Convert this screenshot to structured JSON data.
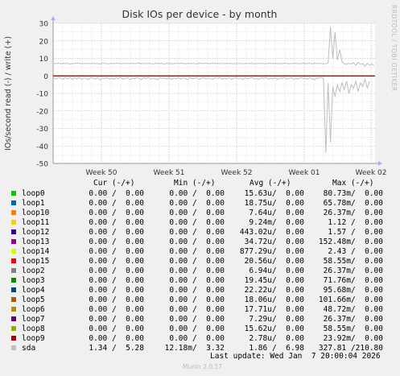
{
  "chart_data": {
    "type": "line",
    "title": "Disk IOs per device - by month",
    "ylabel": "IOs/second read (-) / write (+)",
    "ylim": [
      -50,
      30
    ],
    "yticks": [
      "30",
      "20",
      "10",
      "0",
      "-10",
      "-20",
      "-30",
      "-40",
      "-50"
    ],
    "xticks": [
      "Week 50",
      "Week 51",
      "Week 52",
      "Week 01",
      "Week 02"
    ],
    "grid": true,
    "sda_write": [
      7.2,
      7.0,
      7.3,
      6.9,
      7.1,
      7.0,
      7.2,
      6.8,
      7.1,
      7.0,
      7.3,
      7.1,
      6.9,
      7.2,
      7.0,
      7.1,
      6.9,
      7.2,
      7.0,
      7.1,
      6.8,
      7.2,
      7.1,
      7.0,
      6.9,
      7.2,
      7.0,
      7.1,
      7.3,
      6.9,
      7.0,
      7.2,
      7.1,
      6.9,
      7.2,
      7.0,
      7.1,
      7.3,
      6.9,
      7.1,
      7.0,
      7.2,
      7.0,
      6.9,
      7.1,
      7.2,
      7.0,
      7.1,
      6.8,
      7.2,
      7.0,
      7.1,
      6.9,
      7.3,
      7.0,
      7.1,
      7.2,
      6.9,
      7.0,
      7.2,
      7.1,
      7.0,
      6.9,
      7.2,
      7.1,
      7.0,
      7.3,
      6.9,
      7.1,
      7.2,
      7.0,
      7.1,
      6.9,
      7.2,
      7.0,
      7.1,
      7.0,
      7.2,
      6.9,
      7.1,
      7.0,
      7.2,
      6.9,
      7.1,
      7.0,
      7.2,
      7.1,
      6.9,
      7.0,
      7.2,
      7.1,
      7.0,
      6.9,
      7.2,
      7.1,
      7.0,
      7.2,
      6.9,
      7.1,
      7.0,
      7.2,
      7.1,
      6.9,
      7.0,
      7.2,
      7.1,
      7.0,
      6.9,
      7.3,
      7.0,
      7.1,
      7.2,
      6.9,
      7.1,
      7.0,
      7.2,
      7.1,
      6.9,
      7.0,
      7.2,
      28,
      10,
      25,
      9,
      15,
      8,
      7,
      6.5,
      7.2,
      6.8,
      7.5,
      6.0,
      7.8,
      6.5,
      7.0,
      5.5,
      7.2,
      6.0,
      6.8,
      5.8
    ],
    "sda_read": [
      -1.0,
      -1.8,
      -0.8,
      -1.5,
      -2.0,
      -1.0,
      -1.6,
      -0.9,
      -2.2,
      -1.1,
      -1.7,
      -0.8,
      -1.9,
      -1.2,
      -1.5,
      -2.1,
      -0.9,
      -1.4,
      -1.8,
      -1.0,
      -2.3,
      -1.2,
      -1.6,
      -0.9,
      -1.8,
      -1.3,
      -2.0,
      -1.1,
      -1.5,
      -0.8,
      -1.9,
      -1.4,
      -1.0,
      -2.2,
      -1.2,
      -1.7,
      -0.9,
      -1.6,
      -2.0,
      -1.1,
      -1.4,
      -0.8,
      -1.9,
      -1.3,
      -1.7,
      -2.1,
      -1.0,
      -1.5,
      -1.2,
      -1.8,
      -0.9,
      -2.0,
      -1.3,
      -1.6,
      -1.0,
      -1.9,
      -1.2,
      -1.5,
      -2.2,
      -0.9,
      -1.7,
      -1.3,
      -1.1,
      -2.0,
      -1.4,
      -0.8,
      -1.8,
      -1.2,
      -1.6,
      -2.1,
      -1.0,
      -1.5,
      -0.9,
      -1.9,
      -1.3,
      -1.7,
      -1.1,
      -2.0,
      -1.4,
      -0.8,
      -1.6,
      -1.2,
      -2.2,
      -1.0,
      -1.7,
      -1.3,
      -0.9,
      -1.8,
      -1.5,
      -2.0,
      -1.1,
      -1.4,
      -0.9,
      -1.9,
      -1.3,
      -1.6,
      -1.0,
      -2.1,
      -1.2,
      -1.5,
      -0.8,
      -1.8,
      -1.4,
      -1.1,
      -2.0,
      -1.3,
      -1.7,
      -0.9,
      -1.5,
      -1.2,
      -1.9,
      -1.0,
      -1.6,
      -2.2,
      -1.1,
      -1.4,
      -0.8,
      -1.7,
      -44,
      -4,
      -38,
      -6,
      -12,
      -5,
      -9,
      -4,
      -8,
      -3,
      -10,
      -5,
      -7,
      -3,
      -9,
      -4,
      -6,
      -2,
      -7,
      -3
    ],
    "threshold_line": 0
  },
  "legend": {
    "headers": [
      "Cur (-/+)",
      "Min (-/+)",
      "Avg (-/+)",
      "Max (-/+)"
    ],
    "rows": [
      {
        "name": "loop0",
        "color": "#00cc00",
        "cur": "0.00 /  0.00",
        "min": "0.00 /  0.00",
        "avg": "15.63u/  0.00",
        "max": "80.73m/  0.00"
      },
      {
        "name": "loop1",
        "color": "#0066b3",
        "cur": "0.00 /  0.00",
        "min": "0.00 /  0.00",
        "avg": "18.75u/  0.00",
        "max": "65.78m/  0.00"
      },
      {
        "name": "loop10",
        "color": "#ff8000",
        "cur": "0.00 /  0.00",
        "min": "0.00 /  0.00",
        "avg": "7.64u/  0.00",
        "max": "26.37m/  0.00"
      },
      {
        "name": "loop11",
        "color": "#ffcc00",
        "cur": "0.00 /  0.00",
        "min": "0.00 /  0.00",
        "avg": "9.24m/  0.00",
        "max": "1.12 /  0.00"
      },
      {
        "name": "loop12",
        "color": "#330099",
        "cur": "0.00 /  0.00",
        "min": "0.00 /  0.00",
        "avg": "443.02u/  0.00",
        "max": "1.57 /  0.00"
      },
      {
        "name": "loop13",
        "color": "#990099",
        "cur": "0.00 /  0.00",
        "min": "0.00 /  0.00",
        "avg": "34.72u/  0.00",
        "max": "152.48m/  0.00"
      },
      {
        "name": "loop14",
        "color": "#ccff00",
        "cur": "0.00 /  0.00",
        "min": "0.00 /  0.00",
        "avg": "877.29u/  0.00",
        "max": "2.43 /  0.00"
      },
      {
        "name": "loop15",
        "color": "#ff0000",
        "cur": "0.00 /  0.00",
        "min": "0.00 /  0.00",
        "avg": "20.56u/  0.00",
        "max": "58.55m/  0.00"
      },
      {
        "name": "loop2",
        "color": "#808080",
        "cur": "0.00 /  0.00",
        "min": "0.00 /  0.00",
        "avg": "6.94u/  0.00",
        "max": "26.37m/  0.00"
      },
      {
        "name": "loop3",
        "color": "#008f00",
        "cur": "0.00 /  0.00",
        "min": "0.00 /  0.00",
        "avg": "19.45u/  0.00",
        "max": "71.76m/  0.00"
      },
      {
        "name": "loop4",
        "color": "#00487d",
        "cur": "0.00 /  0.00",
        "min": "0.00 /  0.00",
        "avg": "22.22u/  0.00",
        "max": "95.68m/  0.00"
      },
      {
        "name": "loop5",
        "color": "#b35a00",
        "cur": "0.00 /  0.00",
        "min": "0.00 /  0.00",
        "avg": "18.06u/  0.00",
        "max": "101.66m/  0.00"
      },
      {
        "name": "loop6",
        "color": "#b38f00",
        "cur": "0.00 /  0.00",
        "min": "0.00 /  0.00",
        "avg": "17.71u/  0.00",
        "max": "48.72m/  0.00"
      },
      {
        "name": "loop7",
        "color": "#6b006b",
        "cur": "0.00 /  0.00",
        "min": "0.00 /  0.00",
        "avg": "7.29u/  0.00",
        "max": "26.37m/  0.00"
      },
      {
        "name": "loop8",
        "color": "#8fb300",
        "cur": "0.00 /  0.00",
        "min": "0.00 /  0.00",
        "avg": "15.62u/  0.00",
        "max": "58.55m/  0.00"
      },
      {
        "name": "loop9",
        "color": "#b30000",
        "cur": "0.00 /  0.00",
        "min": "0.00 /  0.00",
        "avg": "2.78u/  0.00",
        "max": "23.92m/  0.00"
      },
      {
        "name": "sda",
        "color": "#bebebe",
        "cur": "1.34 /  5.28",
        "min": "12.18m/  3.32",
        "avg": "1.86 /  6.98",
        "max": "327.81 /210.80"
      }
    ]
  },
  "last_update": "Last update: Wed Jan  7 20:00:04 2026",
  "version": "Munin 2.0.57",
  "watermark": "RRDTOOL / TOBI OETIKER"
}
